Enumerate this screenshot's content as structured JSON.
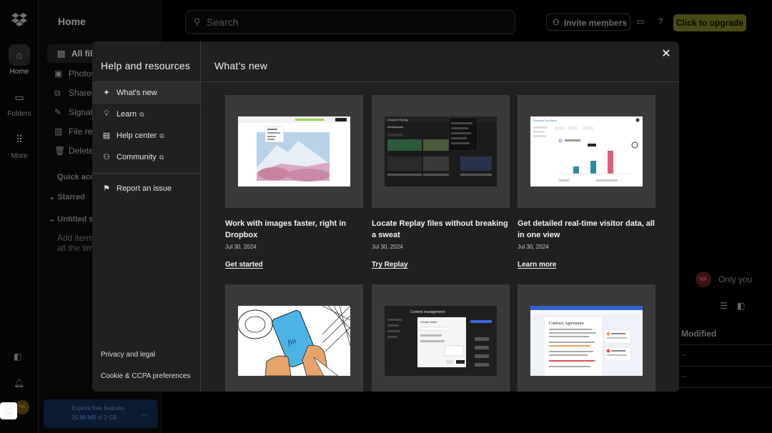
{
  "rail": {
    "items": [
      {
        "label": "Home",
        "icon": "home-icon"
      },
      {
        "label": "Folders",
        "icon": "folder-icon"
      },
      {
        "label": "More",
        "icon": "grid-icon"
      }
    ]
  },
  "sidebar": {
    "title": "Home",
    "items": [
      {
        "label": "All files"
      },
      {
        "label": "Photos"
      },
      {
        "label": "Shared"
      },
      {
        "label": "Signatures"
      },
      {
        "label": "File requests"
      },
      {
        "label": "Deleted files"
      }
    ],
    "quick_access": "Quick access",
    "starred": "Starred",
    "untitled": "Untitled section",
    "empty_note_1": "Add items",
    "empty_note_2": "all the time",
    "explore_1": "Explore free features",
    "explore_2": "25.88 MB of 2 GB"
  },
  "topbar": {
    "search_placeholder": "Search",
    "invite_label": "Invite members",
    "upgrade_label": "Click to upgrade"
  },
  "main": {
    "member_initials": "NK",
    "member_label": "Only you",
    "modified_header": "Modified",
    "dash": "--",
    "user_initials": "NK"
  },
  "modal": {
    "left_title": "Help and resources",
    "nav": [
      {
        "label": "What's new",
        "icon": "sparkle-icon",
        "external": false
      },
      {
        "label": "Learn",
        "icon": "lightbulb-icon",
        "external": true
      },
      {
        "label": "Help center",
        "icon": "book-icon",
        "external": true
      },
      {
        "label": "Community",
        "icon": "community-icon",
        "external": true
      },
      {
        "label": "Report an issue",
        "icon": "flag-icon",
        "external": false
      }
    ],
    "footer_links": [
      "Privacy and legal",
      "Cookie & CCPA preferences"
    ],
    "right_title": "What’s new",
    "cards": [
      {
        "title": "Work with images faster, right in Dropbox",
        "date": "Jul 30, 2024",
        "link": "Get started"
      },
      {
        "title": "Locate Replay files without breaking a sweat",
        "date": "Jul 30, 2024",
        "link": "Try Replay"
      },
      {
        "title": "Get detailed real-time visitor data, all in one view",
        "date": "Jul 30, 2024",
        "link": "Learn more"
      },
      {
        "title": "",
        "date": "",
        "link": ""
      },
      {
        "title": "",
        "date": "",
        "link": ""
      },
      {
        "title": "",
        "date": "",
        "link": ""
      }
    ],
    "thumb_texts": {
      "replay_brand": "Dropbox Replay",
      "replay_section": "Workspaces",
      "docsend_brand": "Dropbox DocSend",
      "cm_title": "Content management",
      "cm_dialog": "Create folder",
      "contract_title": "Contract Agreement"
    }
  }
}
